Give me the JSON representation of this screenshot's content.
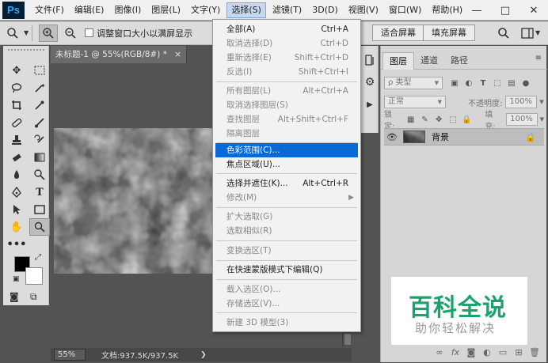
{
  "app": {
    "logo": "Ps",
    "menus": [
      "文件(F)",
      "编辑(E)",
      "图像(I)",
      "图层(L)",
      "文字(Y)",
      "选择(S)",
      "滤镜(T)",
      "3D(D)",
      "视图(V)",
      "窗口(W)",
      "帮助(H)"
    ],
    "active_menu": "选择(S)",
    "window_controls": {
      "minimize": "—",
      "maximize": "□",
      "close": "✕"
    }
  },
  "options_bar": {
    "checkbox_label": "调整窗口大小以满屏显示",
    "fit_screen_button": "适合屏幕",
    "fill_screen_button": "填充屏幕"
  },
  "document": {
    "tab_title": "未标题-1 @ 55%(RGB/8#) *",
    "tab_close": "×",
    "zoom": "55%",
    "doc_info": "文档:937.5K/937.5K",
    "info_arrow": "❯"
  },
  "select_menu": {
    "items": [
      {
        "label": "全部(A)",
        "shortcut": "Ctrl+A",
        "enabled": true
      },
      {
        "label": "取消选择(D)",
        "shortcut": "Ctrl+D",
        "enabled": false
      },
      {
        "label": "重新选择(E)",
        "shortcut": "Shift+Ctrl+D",
        "enabled": false
      },
      {
        "label": "反选(I)",
        "shortcut": "Shift+Ctrl+I",
        "enabled": false
      },
      {
        "label": "所有图层(L)",
        "shortcut": "Alt+Ctrl+A",
        "enabled": false
      },
      {
        "label": "取消选择图层(S)",
        "shortcut": "",
        "enabled": false
      },
      {
        "label": "查找图层",
        "shortcut": "Alt+Shift+Ctrl+F",
        "enabled": false
      },
      {
        "label": "隔离图层",
        "shortcut": "",
        "enabled": false
      },
      {
        "label": "色彩范围(C)...",
        "shortcut": "",
        "enabled": true,
        "highlighted": true
      },
      {
        "label": "焦点区域(U)...",
        "shortcut": "",
        "enabled": true
      },
      {
        "label": "选择并遮住(K)...",
        "shortcut": "Alt+Ctrl+R",
        "enabled": true
      },
      {
        "label": "修改(M)",
        "shortcut": "",
        "enabled": false,
        "submenu": true
      },
      {
        "label": "扩大选取(G)",
        "shortcut": "",
        "enabled": false
      },
      {
        "label": "选取相似(R)",
        "shortcut": "",
        "enabled": false
      },
      {
        "label": "变换选区(T)",
        "shortcut": "",
        "enabled": false
      },
      {
        "label": "在快速蒙版模式下编辑(Q)",
        "shortcut": "",
        "enabled": true
      },
      {
        "label": "载入选区(O)...",
        "shortcut": "",
        "enabled": false
      },
      {
        "label": "存储选区(V)...",
        "shortcut": "",
        "enabled": false
      },
      {
        "label": "新建 3D 模型(3)",
        "shortcut": "",
        "enabled": false
      }
    ]
  },
  "layers_panel": {
    "tabs": [
      "图层",
      "通道",
      "路径"
    ],
    "active_tab": "图层",
    "filter_label": "ρ 类型",
    "blend_mode": "正常",
    "opacity_label": "不透明度:",
    "opacity_value": "100%",
    "lock_label": "锁定:",
    "fill_label": "填充:",
    "fill_value": "100%",
    "layers": [
      {
        "name": "背景",
        "visible": true,
        "locked": true
      }
    ],
    "footer_icons": [
      "link-icon",
      "fx-icon",
      "mask-icon",
      "adjustment-icon",
      "group-icon",
      "new-layer-icon",
      "trash-icon"
    ]
  },
  "watermark": {
    "title": "百科全说",
    "subtitle": "助你轻松解决"
  }
}
